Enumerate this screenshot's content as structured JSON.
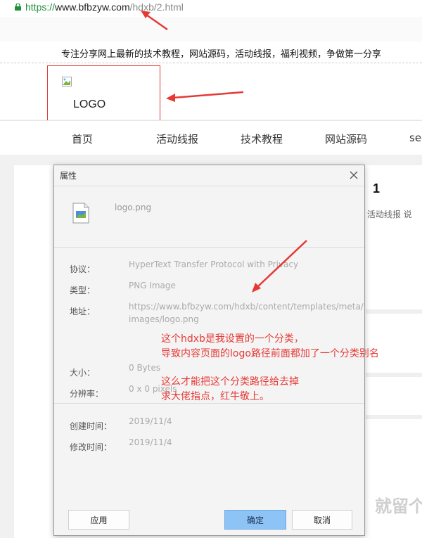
{
  "browser": {
    "url_scheme": "https://",
    "url_host": "www.bfbzyw.com",
    "url_path": "/hdxb/2.html"
  },
  "site": {
    "tagline": "专注分享网上最新的技术教程，网站源码，活动线报，福利视频，争做第一分享",
    "logo_text": "LOGO",
    "nav": [
      "首页",
      "活动线报",
      "技术教程",
      "网站源码",
      "seo"
    ],
    "article_num": "1",
    "article_meta": ": 活动线报   说",
    "watermark": "就留个"
  },
  "dialog": {
    "title": "属性",
    "file_name": "logo.png",
    "fields": {
      "protocol_label": "协议：",
      "protocol_value": "HyperText Transfer Protocol with Privacy",
      "type_label": "类型：",
      "type_value": "PNG Image",
      "address_label": "地址：",
      "address_value_line1": "https://www.bfbzyw.com/hdxb/content/templates/meta/",
      "address_value_line2": "images/logo.png",
      "size_label": "大小：",
      "size_value": "0 Bytes",
      "resolution_label": "分辨率：",
      "resolution_value": "0 x 0 pixels",
      "created_label": "创建时间：",
      "created_value": "2019/11/4",
      "modified_label": "修改时间：",
      "modified_value": "2019/11/4"
    },
    "buttons": {
      "apply": "应用",
      "ok": "确定",
      "cancel": "取消"
    }
  },
  "annotations": {
    "note1_line1": "这个hdxb是我设置的一个分类，",
    "note1_line2": "导致内容页面的logo路径前面都加了一个分类别名",
    "note2_line1": "这么才能把这个分类路径给去掉",
    "note2_line2": "求大佬指点，红牛敬上。"
  },
  "colors": {
    "annotation_red": "#e53935",
    "ok_button": "#8ec3f5",
    "lock_green": "#1f8f3a"
  }
}
